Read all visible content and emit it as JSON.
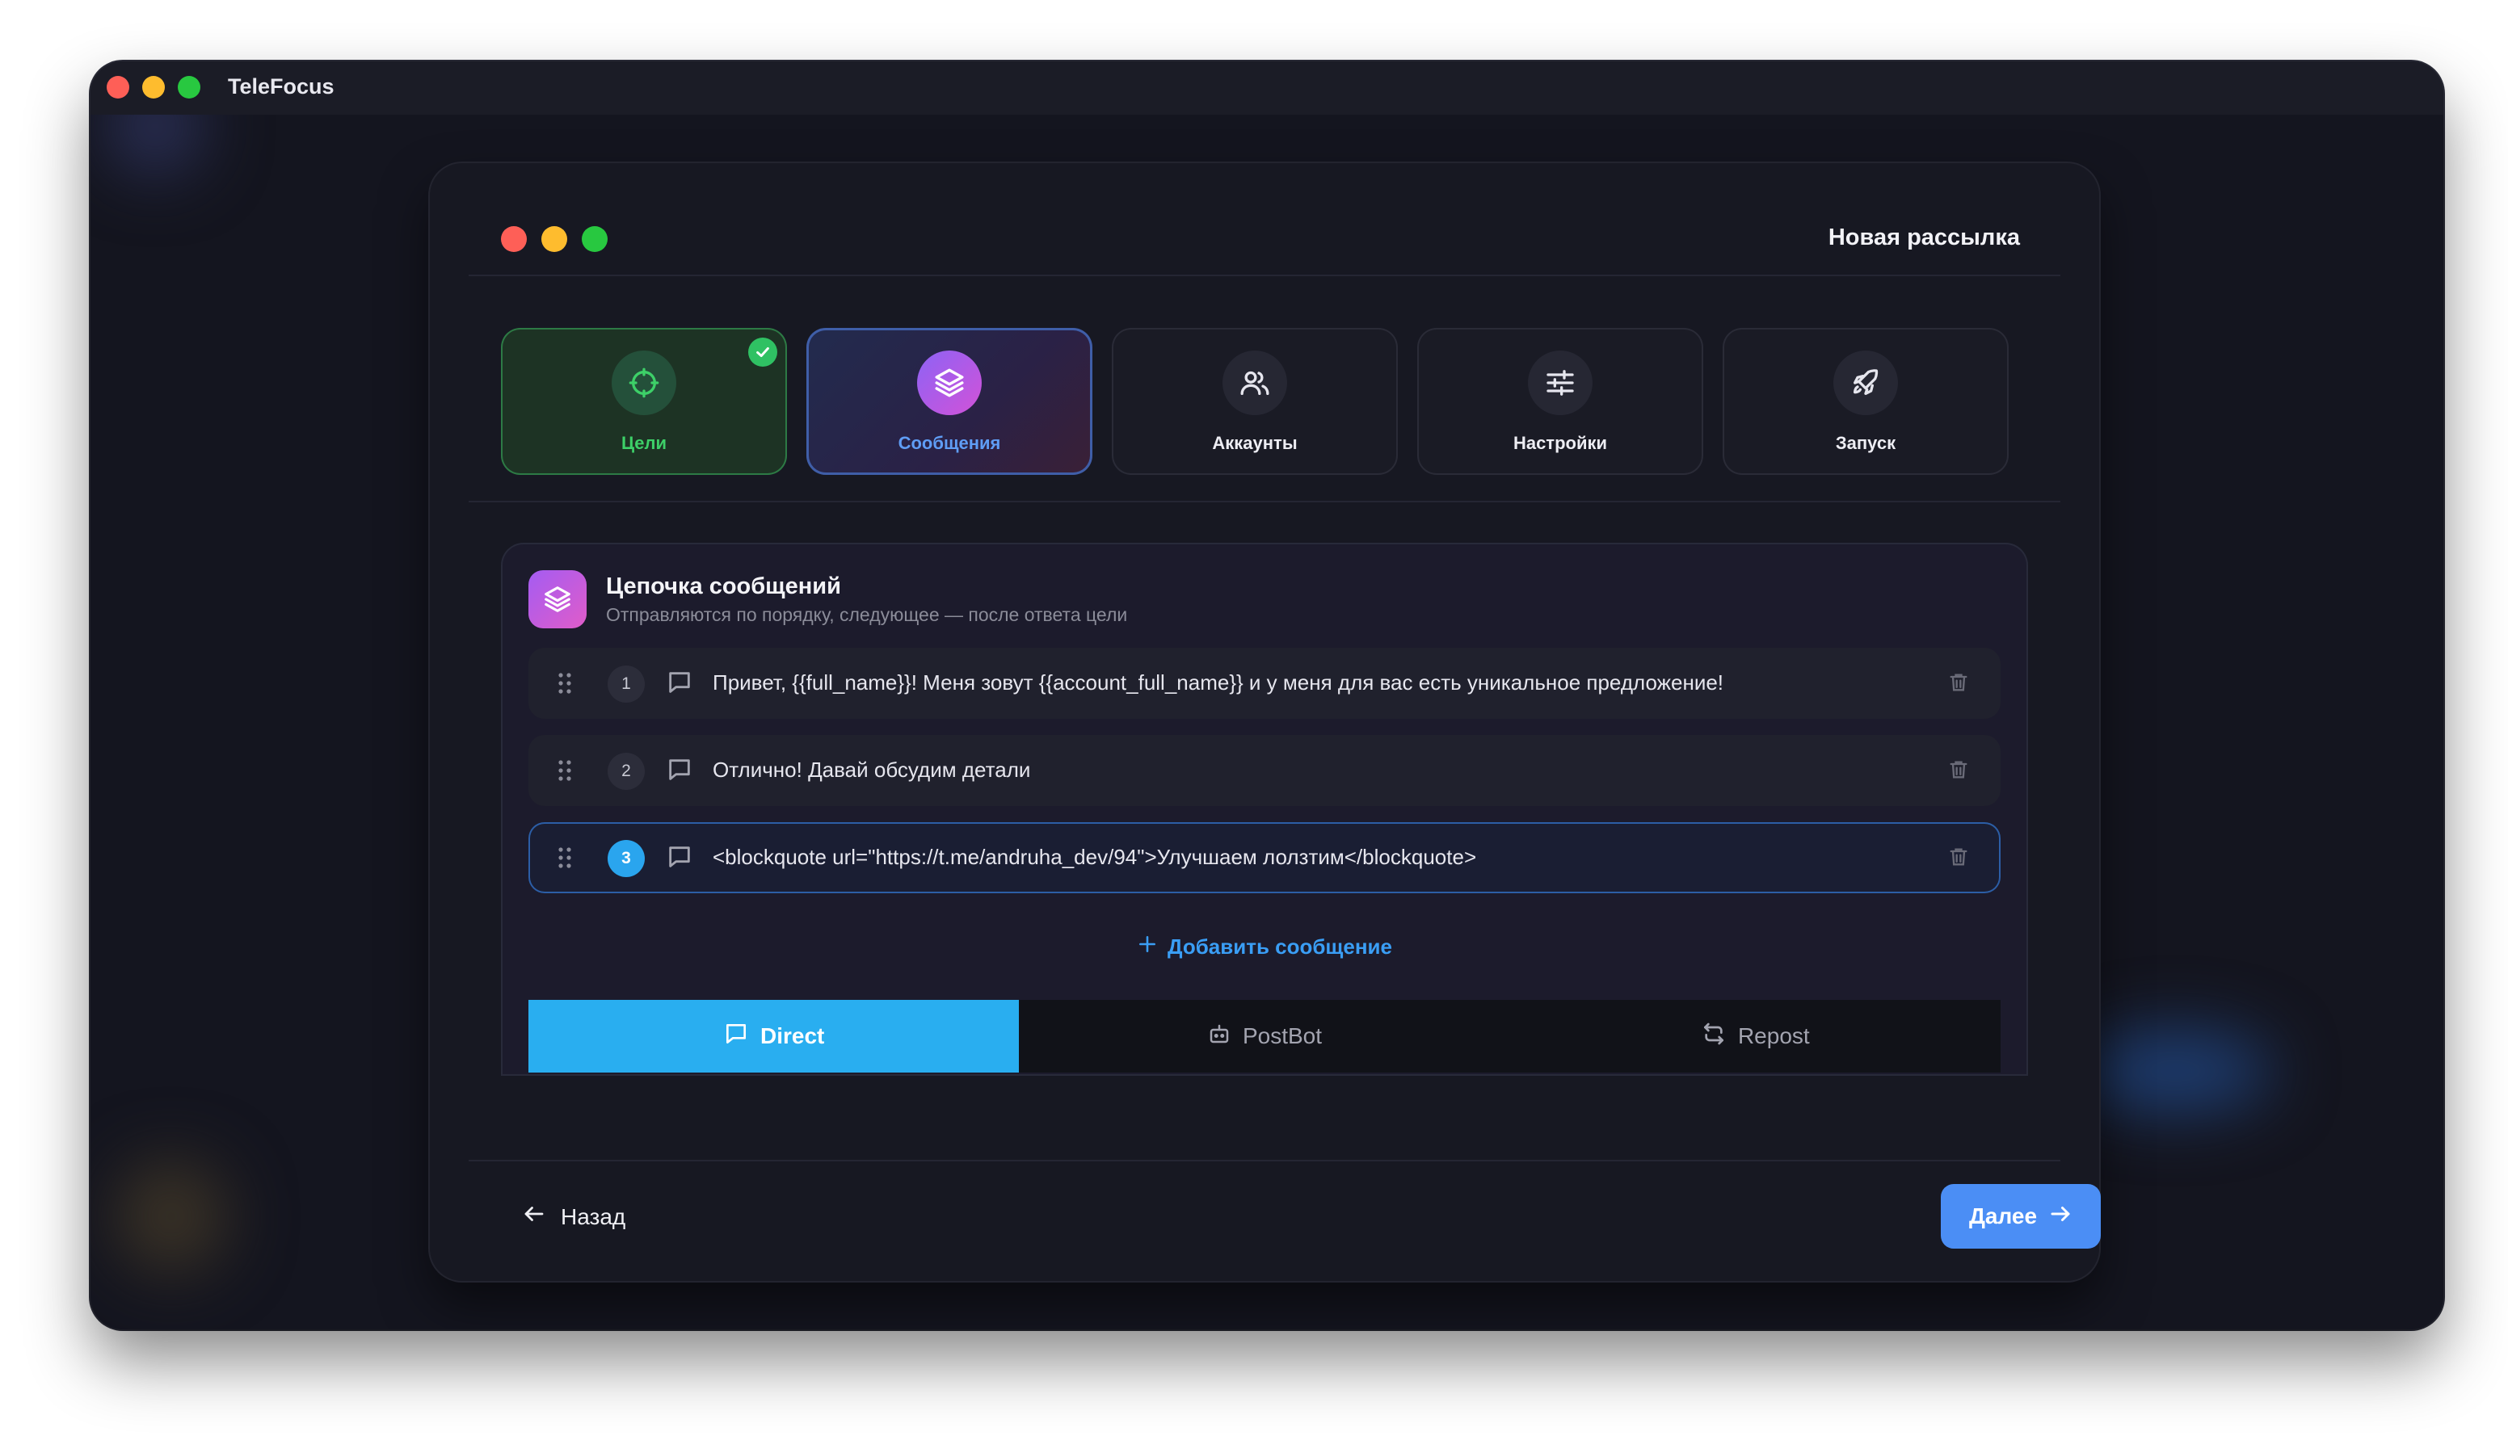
{
  "app": {
    "title": "TeleFocus"
  },
  "dialog": {
    "title": "Новая рассылка"
  },
  "steps": [
    {
      "label": "Цели",
      "state": "done",
      "icon": "target-icon"
    },
    {
      "label": "Сообщения",
      "state": "active",
      "icon": "layers-icon"
    },
    {
      "label": "Аккаунты",
      "state": "pending",
      "icon": "users-icon"
    },
    {
      "label": "Настройки",
      "state": "pending",
      "icon": "sliders-icon"
    },
    {
      "label": "Запуск",
      "state": "pending",
      "icon": "rocket-icon"
    }
  ],
  "chain": {
    "title": "Цепочка сообщений",
    "subtitle": "Отправляются по порядку, следующее — после ответа цели",
    "messages": [
      {
        "number": "1",
        "text": "Привет, {{full_name}}! Меня зовут {{account_full_name}} и у меня для вас есть уникальное предложение!"
      },
      {
        "number": "2",
        "text": "Отлично! Давай обсудим детали"
      },
      {
        "number": "3",
        "text": "<blockquote url=\"https://t.me/andruha_dev/94\">Улучшаем лолзтим</blockquote>"
      }
    ],
    "add_label": "Добавить сообщение"
  },
  "modes": [
    {
      "label": "Direct",
      "active": true
    },
    {
      "label": "PostBot",
      "active": false
    },
    {
      "label": "Repost",
      "active": false
    }
  ],
  "footer": {
    "back_label": "Назад",
    "next_label": "Далее"
  },
  "colors": {
    "accent_blue": "#29aef0",
    "next_button": "#4b8ef5",
    "done_green": "#3dd068",
    "active_step_label": "#5f9df5"
  }
}
